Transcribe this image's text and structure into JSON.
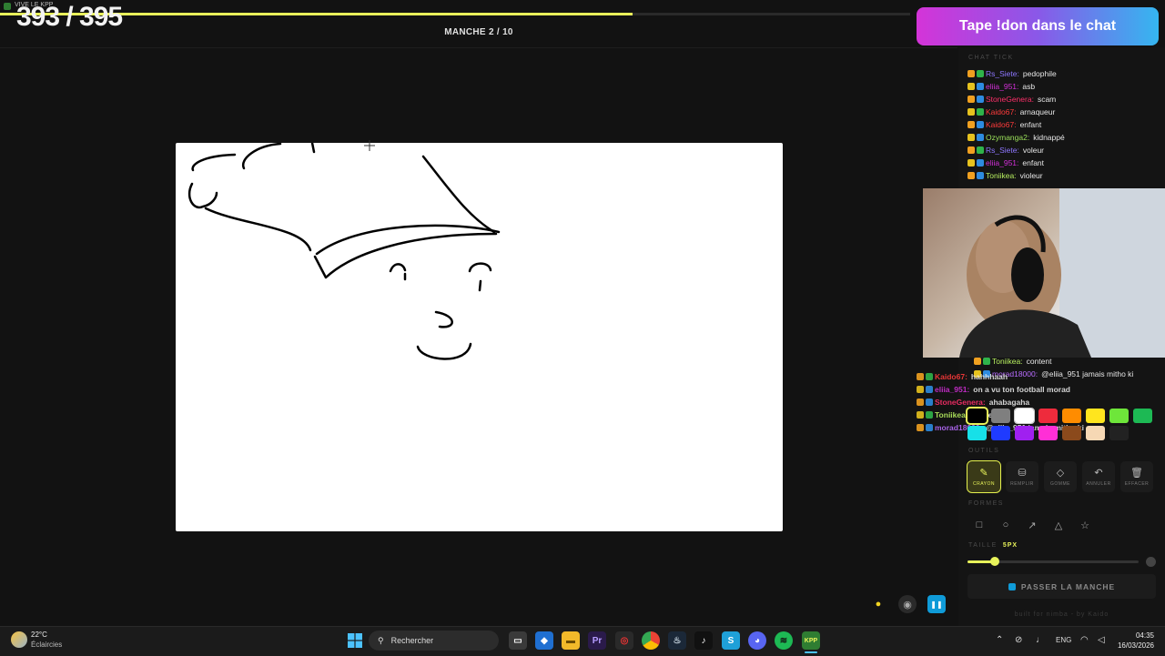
{
  "app": {
    "title": "VIVE LE KPP"
  },
  "game": {
    "score": "393 / 395",
    "round_label": "MANCHE 2 / 10",
    "progress_fraction": 0.695
  },
  "banner": {
    "text": "Tape !don dans le chat"
  },
  "chat": {
    "label": "CHAT TICK",
    "messages": [
      {
        "user": "Rs_Siete",
        "msg": "pedophile",
        "color": "#8e77ff"
      },
      {
        "user": "eliia_951",
        "msg": "asb",
        "color": "#d22fd8"
      },
      {
        "user": "StoneGenera",
        "msg": "scam",
        "color": "#ff2f6a"
      },
      {
        "user": "Kaido67",
        "msg": "arnaqueur",
        "color": "#ff3b3b"
      },
      {
        "user": "Kaido67",
        "msg": "enfant",
        "color": "#ff3b3b"
      },
      {
        "user": "Ozymanga2",
        "msg": "kidnappé",
        "color": "#9be05a"
      },
      {
        "user": "Rs_Siete",
        "msg": "voleur",
        "color": "#8e77ff"
      },
      {
        "user": "eliia_951",
        "msg": "enfant",
        "color": "#d22fd8"
      },
      {
        "user": "Toniikea",
        "msg": "violeur",
        "color": "#b8f060"
      }
    ],
    "messages_below_cam": [
      {
        "user": "Toniikea",
        "msg": "content",
        "color": "#b8f060"
      },
      {
        "user": "morad18000",
        "msg": "@eliia_951 jamais mitho ki",
        "color": "#b96cff"
      }
    ]
  },
  "overlay_chat": {
    "lines": [
      {
        "user": "Kaido67",
        "msg": "hahhhaah",
        "color": "#ff3b3b"
      },
      {
        "user": "eliia_951",
        "msg": "on a vu ton football morad",
        "color": "#d22fd8"
      },
      {
        "user": "StoneGenera",
        "msg": "ahabagaha",
        "color": "#ff2f6a"
      },
      {
        "user": "Toniikea",
        "msg": "content",
        "color": "#b8f060"
      },
      {
        "user": "morad18000",
        "msg": "@eliia_951 jamais mitho ki",
        "color": "#b96cff"
      }
    ]
  },
  "palette": {
    "row1": [
      "#000000",
      "#7f7f7f",
      "#ffffff",
      "#ee2b3c",
      "#ff8c00",
      "#ffe51e",
      "#6ee63a",
      "#1db954"
    ],
    "row2": [
      "#17e0e8",
      "#1f3bff",
      "#a020f0",
      "#ff2fd6",
      "#8b4a1c",
      "#f6d8b4",
      "#222222"
    ]
  },
  "tools": {
    "label": "OUTILS",
    "items": [
      {
        "label": "CRAYON",
        "icon": "pencil-icon"
      },
      {
        "label": "REMPLIR",
        "icon": "fill-icon"
      },
      {
        "label": "GOMME",
        "icon": "eraser-icon"
      },
      {
        "label": "ANNULER",
        "icon": "undo-icon"
      },
      {
        "label": "EFFACER",
        "icon": "trash-icon"
      }
    ]
  },
  "shapes": {
    "label": "FORMES"
  },
  "size": {
    "label": "TAILLE",
    "value": "5PX",
    "fraction": 0.16
  },
  "skip_button": {
    "label": "PASSER LA MANCHE"
  },
  "footer": {
    "credit": "built for nimba - by Kaido"
  },
  "taskbar": {
    "weather_temp": "22°C",
    "weather_desc": "Éclaircies",
    "search_placeholder": "Rechercher",
    "language": "ENG",
    "time": "04:35",
    "date": "16/03/2026"
  }
}
